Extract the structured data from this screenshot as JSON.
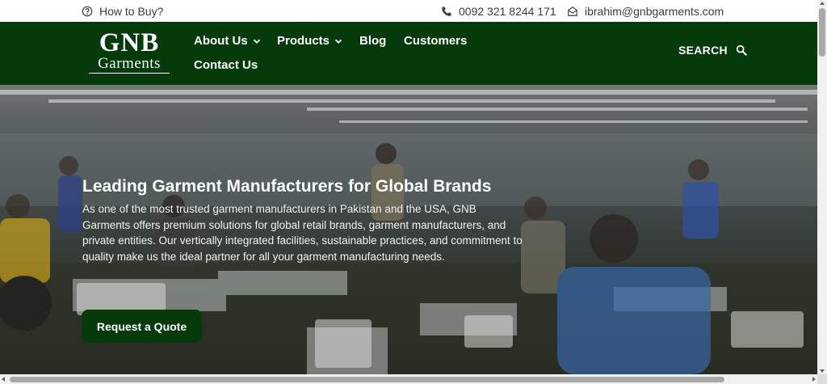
{
  "topbar": {
    "how_to_buy": "How to Buy?",
    "phone": "0092 321 8244 171",
    "email": "ibrahim@gnbgarments.com"
  },
  "logo": {
    "line1": "GNB",
    "line2": "Garments"
  },
  "nav": {
    "about": "About Us",
    "products": "Products",
    "blog": "Blog",
    "customers": "Customers",
    "contact": "Contact Us"
  },
  "search": {
    "label": "SEARCH"
  },
  "hero": {
    "title": "Leading Garment Manufacturers for Global Brands",
    "text": "As one of the most trusted garment manufacturers in Pakistan and the USA, GNB Garments offers premium solutions for global retail brands, garment manufacturers, and private entities. Our vertically integrated facilities, sustainable practices, and commitment to quality make us the ideal partner for all your garment manufacturing needs.",
    "cta": "Request a Quote"
  },
  "colors": {
    "brand_green": "#053a0b",
    "topbar_text": "#3b3b3b"
  }
}
